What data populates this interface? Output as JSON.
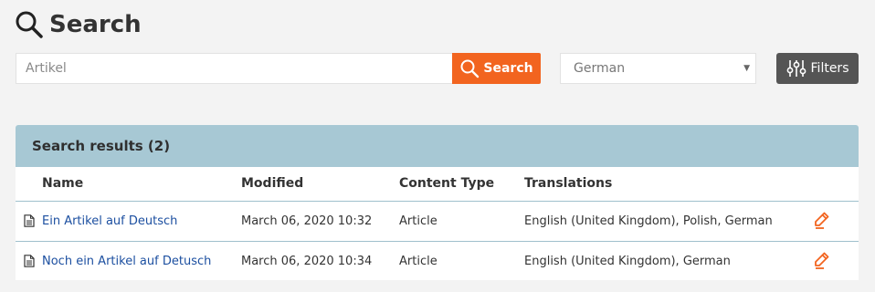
{
  "header": {
    "title": "Search",
    "icon": "search-icon"
  },
  "search": {
    "placeholder": "Artikel",
    "value": "",
    "button_label": "Search",
    "button_icon": "search-icon"
  },
  "language": {
    "selected": "German",
    "icon": "chevron-down-icon"
  },
  "filters": {
    "label": "Filters",
    "icon": "sliders-icon"
  },
  "results": {
    "title": "Search results (2)",
    "columns": [
      "Name",
      "Modified",
      "Content Type",
      "Translations",
      ""
    ],
    "rows": [
      {
        "name": "Ein Artikel auf Deutsch",
        "modified": "March 06, 2020 10:32",
        "content_type": "Article",
        "translations": "English (United Kingdom), Polish, German"
      },
      {
        "name": "Noch ein Artikel auf Detusch",
        "modified": "March 06, 2020 10:34",
        "content_type": "Article",
        "translations": "English (United Kingdom), German"
      }
    ]
  },
  "colors": {
    "accent": "#f2641f",
    "panel_header": "#a7c8d4",
    "link": "#1c4fa0",
    "filters_button": "#555555"
  }
}
